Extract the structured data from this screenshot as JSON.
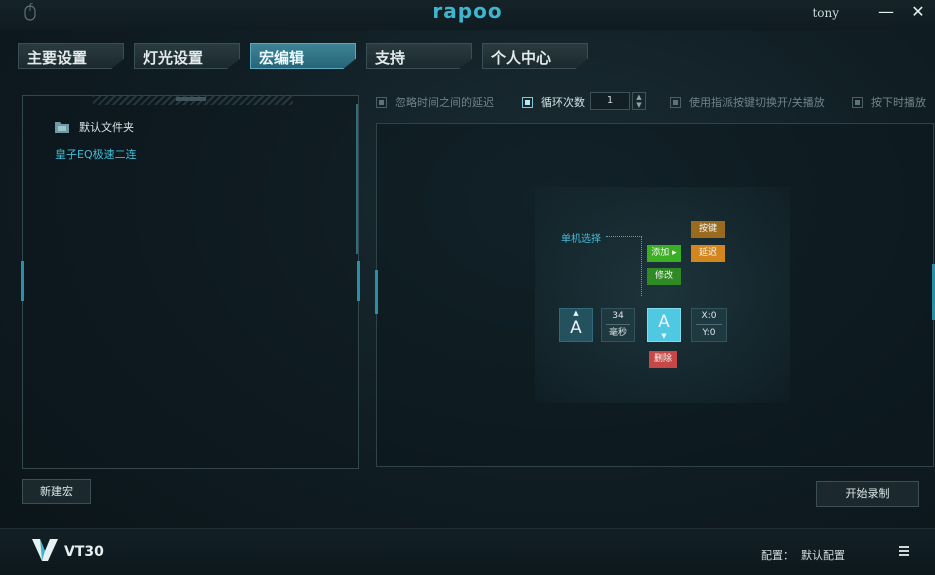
{
  "window": {
    "brand": "rapoo",
    "user": "tony",
    "minimize_icon": "minus-icon",
    "close_icon": "close-icon"
  },
  "tabs": [
    {
      "label": "主要设置",
      "active": false
    },
    {
      "label": "灯光设置",
      "active": false
    },
    {
      "label": "宏编辑",
      "active": true
    },
    {
      "label": "支持",
      "active": false
    },
    {
      "label": "个人中心",
      "active": false
    }
  ],
  "macro_list": {
    "folder": "默认文件夹",
    "items": [
      "皇子EQ极速二连"
    ]
  },
  "options": {
    "ignore_delay": {
      "label": "忽略时间之间的延迟",
      "checked": false
    },
    "loop_count": {
      "label": "循环次数",
      "checked": true,
      "value": "1"
    },
    "toggle_key": {
      "label": "使用指派按键切换开/关播放",
      "checked": false
    },
    "press_play": {
      "label": "按下时播放",
      "checked": false
    }
  },
  "editor_help": {
    "hint": "单机选择",
    "add": "添加",
    "edit": "修改",
    "key": "按键",
    "delay": "延迟",
    "delete": "删除",
    "key_a_1": "A",
    "key_a_2": "A",
    "delay_value": "34",
    "delay_unit": "毫秒",
    "x": "X:0",
    "y": "Y:0"
  },
  "buttons": {
    "new_macro": "新建宏",
    "start_record": "开始录制"
  },
  "footer": {
    "model": "VT30",
    "config_label": "配置：",
    "config_value": "默认配置"
  },
  "colors": {
    "accent": "#3fb6d0",
    "active_tab": "#2f7a8d",
    "add_green": "#3cae24",
    "edit_green": "#2f8a23",
    "key_brown": "#9a6b1e",
    "delay_orange": "#d4861e",
    "delete_red": "#c64747"
  }
}
